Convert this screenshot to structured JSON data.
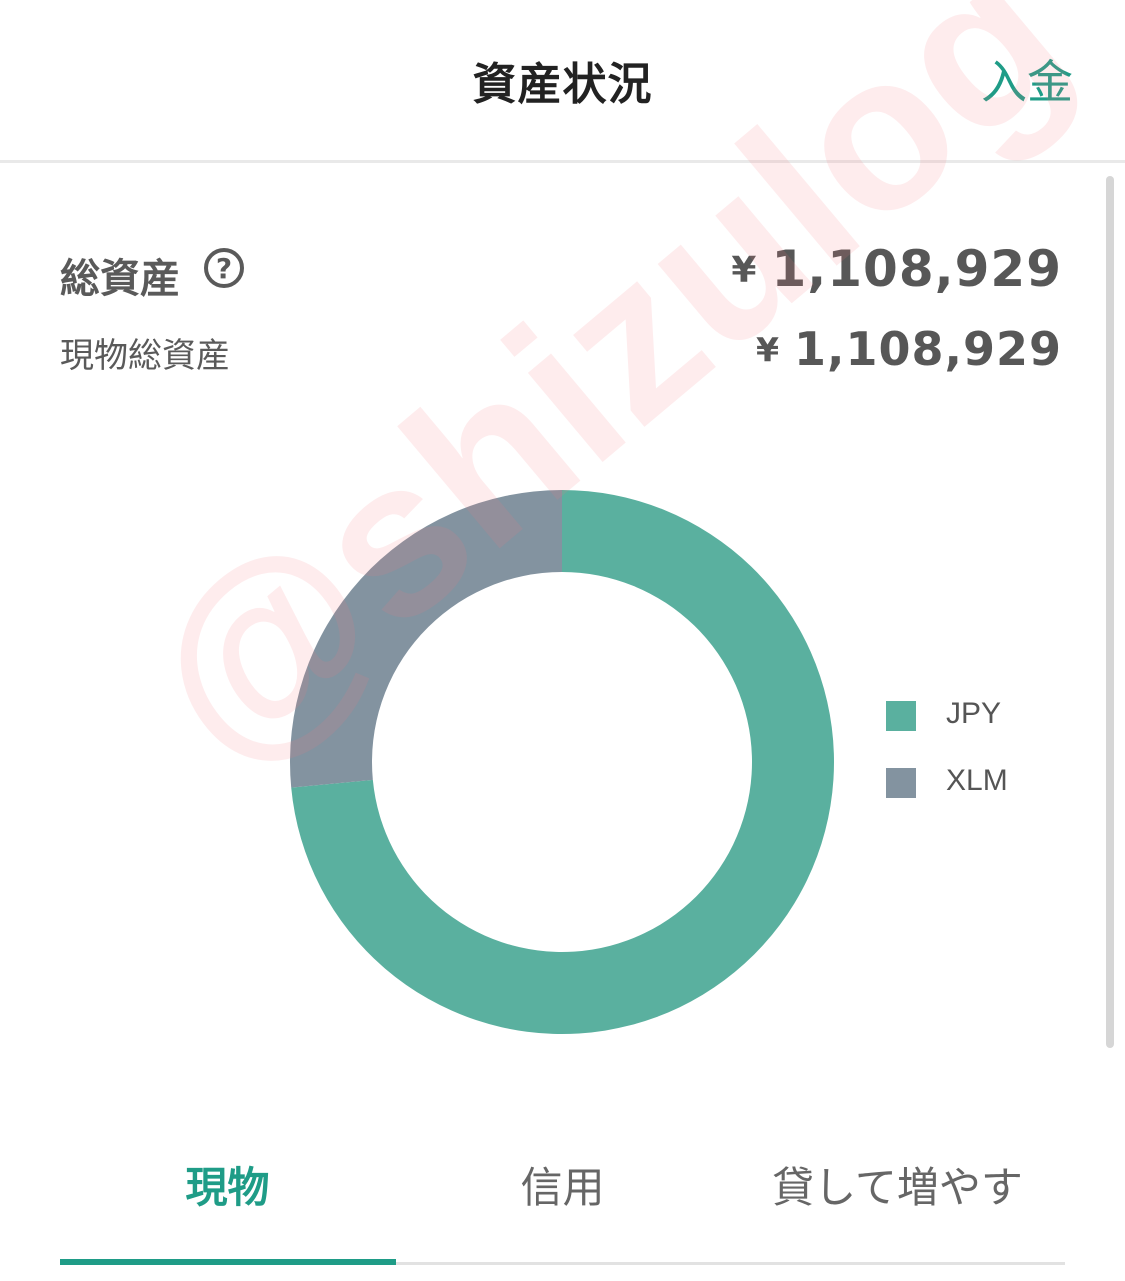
{
  "header": {
    "title": "資産状況",
    "deposit_label": "入金"
  },
  "summary": {
    "total_label": "総資産",
    "help_icon_glyph": "?",
    "currency_symbol": "¥",
    "total_value": "1,108,929",
    "spot_label": "現物総資産",
    "spot_value": "1,108,929"
  },
  "chart_data": {
    "type": "pie",
    "donut": true,
    "series": [
      {
        "name": "JPY",
        "value": 0.735,
        "color": "#5ab09f"
      },
      {
        "name": "XLM",
        "value": 0.265,
        "color": "#8393a0"
      }
    ],
    "legend_position": "right"
  },
  "watermark": "@shizulog",
  "tabs": [
    {
      "label": "現物",
      "active": true
    },
    {
      "label": "信用",
      "active": false
    },
    {
      "label": "貸して増やす",
      "active": false
    }
  ],
  "colors": {
    "accent": "#1f9c87"
  }
}
